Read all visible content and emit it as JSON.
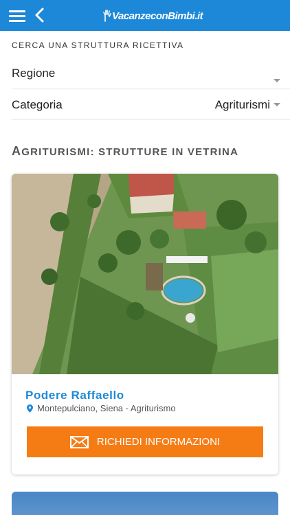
{
  "topbar": {
    "menu_icon": "hamburger-icon",
    "back_icon": "chevron-left-icon",
    "logo_text": "VacanzeconBimbi.it",
    "color": "#1e88d8"
  },
  "search": {
    "title": "CERCA UNA STRUTTURA RICETTIVA",
    "region_label": "Regione",
    "region_value": "",
    "category_label": "Categoria",
    "category_value": "Agriturismi"
  },
  "showcase": {
    "title_first": "A",
    "title_rest": "GRITURISMI: STRUTTURE IN VETRINA",
    "cards": [
      {
        "name": "Podere Raffaello",
        "location": "Montepulciano, Siena - Agriturismo",
        "button_label": "RICHIEDI INFORMAZIONI",
        "button_icon": "envelope-icon",
        "button_color": "#f57c15"
      }
    ]
  }
}
